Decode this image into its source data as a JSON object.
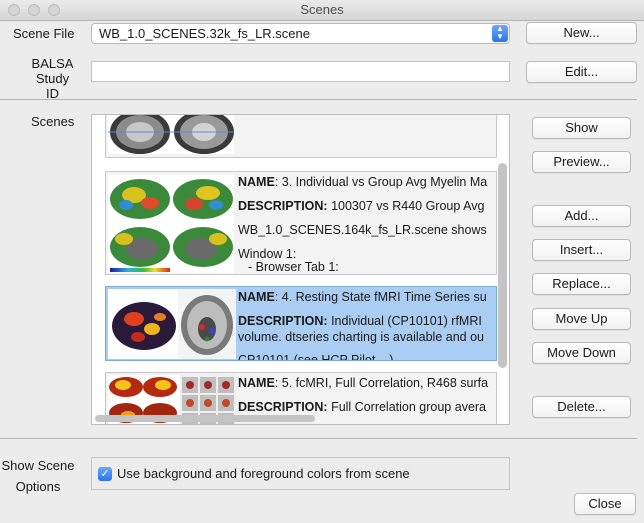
{
  "window": {
    "title": "Scenes"
  },
  "scene_file": {
    "label": "Scene File",
    "value": "WB_1.0_SCENES.32k_fs_LR.scene",
    "new_button": "New..."
  },
  "balsa": {
    "label_line1": "BALSA",
    "label_line2": "Study ID",
    "value": "",
    "edit_button": "Edit..."
  },
  "scenes": {
    "label": "Scenes",
    "items": [
      {},
      {
        "name_key": "NAME",
        "name": ": 3. Individual vs Group Avg Myelin Ma",
        "desc_key": "DESCRIPTION:",
        "desc": " 100307 vs R440 Group Avg",
        "line3": "WB_1.0_SCENES.164k_fs_LR.scene shows",
        "line4": "Window 1:",
        "line5": "- Browser Tab 1:"
      },
      {
        "name_key": "NAME",
        "name": ": 4. Resting State fMRI Time Series su",
        "desc_key": "DESCRIPTION:",
        "desc": " Individual (CP10101) rfMRI",
        "desc2": "volume. dtseries charting is available and ou",
        "line3": "CP10101 (see HCP Pilot ...)"
      },
      {
        "name_key": "NAME",
        "name": ": 5. fcMRI, Full Correlation, R468 surfa",
        "desc_key": "DESCRIPTION:",
        "desc": " Full Correlation group avera"
      }
    ]
  },
  "buttons": {
    "show": "Show",
    "preview": "Preview...",
    "add": "Add...",
    "insert": "Insert...",
    "replace": "Replace...",
    "move_up": "Move Up",
    "move_down": "Move Down",
    "delete": "Delete...",
    "close": "Close"
  },
  "options": {
    "label_line1": "Show Scene",
    "label_line2": "Options",
    "checkbox_label": "Use background and foreground colors from scene",
    "checked": true
  },
  "colors": {
    "selection": "#aacdf4",
    "accent_blue": "#2a74e8"
  }
}
